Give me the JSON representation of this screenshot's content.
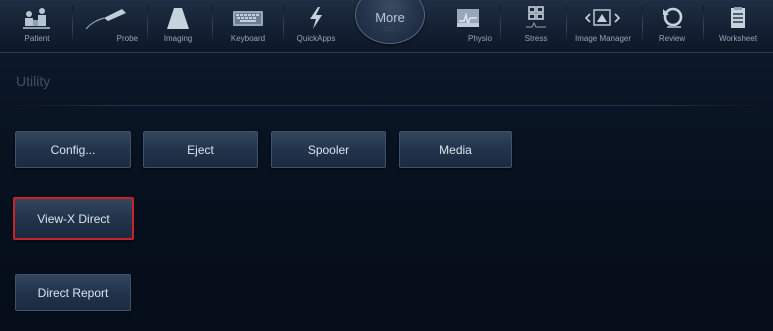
{
  "toolbar": {
    "items": [
      {
        "label": "Patient",
        "icon": "patient-icon"
      },
      {
        "label": "Probe",
        "icon": "probe-icon"
      },
      {
        "label": "Imaging",
        "icon": "imaging-icon"
      },
      {
        "label": "Keyboard",
        "icon": "keyboard-icon"
      },
      {
        "label": "QuickApps",
        "icon": "quickapps-icon"
      },
      {
        "label": "Physio",
        "icon": "physio-icon"
      },
      {
        "label": "Stress",
        "icon": "stress-icon"
      },
      {
        "label": "Image Manager",
        "icon": "image-manager-icon"
      },
      {
        "label": "Review",
        "icon": "review-icon"
      },
      {
        "label": "Worksheet",
        "icon": "worksheet-icon"
      }
    ],
    "more_label": "More",
    "more_dots": "::::"
  },
  "page": {
    "title": "Utility"
  },
  "buttons": {
    "config": "Config...",
    "eject": "Eject",
    "spooler": "Spooler",
    "media": "Media",
    "view_x_direct": "View-X Direct",
    "direct_report": "Direct Report"
  },
  "colors": {
    "highlight": "#c8222a",
    "background": "#06101d",
    "button_text": "#dbe4ee"
  }
}
